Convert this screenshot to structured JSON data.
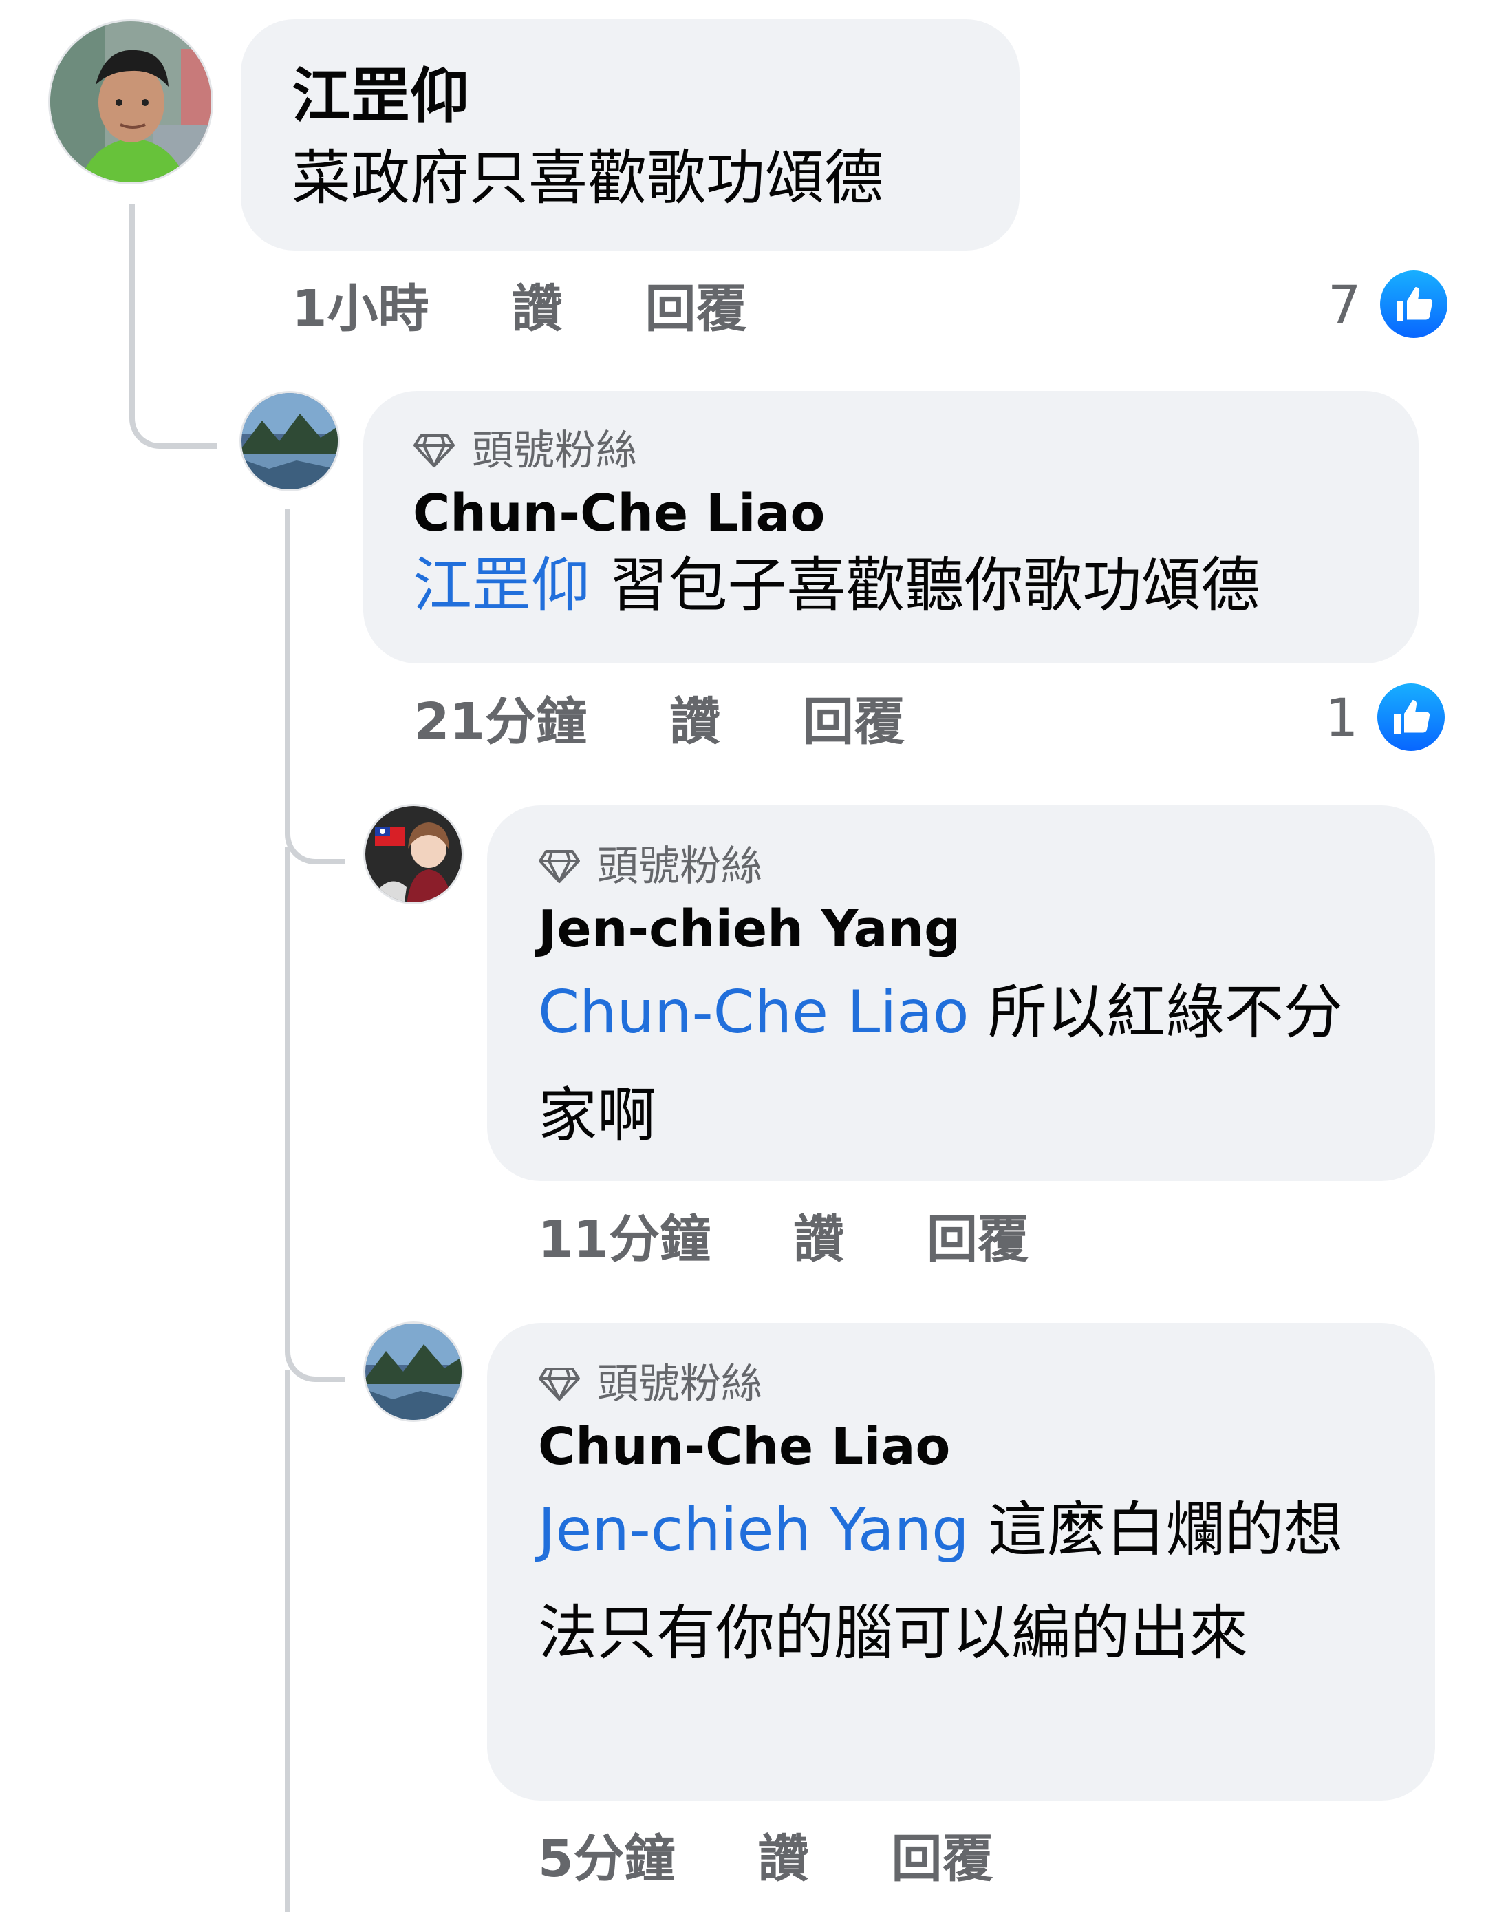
{
  "comments": [
    {
      "author": "江罡仰",
      "text": "菜政府只喜歡歌功頌德",
      "time": "1小時",
      "like_label": "讚",
      "reply_label": "回覆",
      "reaction_count": "7",
      "avatar_icon": "user-avatar-photo"
    },
    {
      "badge": "頭號粉絲",
      "author": "Chun-Che Liao",
      "mention": "江罡仰",
      "text": " 習包子喜歡聽你歌功頌德",
      "time": "21分鐘",
      "like_label": "讚",
      "reply_label": "回覆",
      "reaction_count": "1",
      "avatar_icon": "landscape-avatar-photo"
    },
    {
      "badge": "頭號粉絲",
      "author": "Jen-chieh Yang",
      "mention": "Chun-Che Liao",
      "text": " 所以紅綠不分家啊",
      "time": "11分鐘",
      "like_label": "讚",
      "reply_label": "回覆",
      "avatar_icon": "anime-avatar-photo"
    },
    {
      "badge": "頭號粉絲",
      "author": "Chun-Che Liao",
      "mention": "Jen-chieh Yang",
      "text": " 這麼白爛的想法只有你的腦可以編的出來",
      "time": "5分鐘",
      "like_label": "讚",
      "reply_label": "回覆",
      "avatar_icon": "landscape-avatar-photo"
    }
  ],
  "colors": {
    "bubble": "#f0f2f5",
    "mention": "#216fdb",
    "meta": "#65676b",
    "like_badge": "#0866ff",
    "thread_line": "#cfd2d6"
  }
}
